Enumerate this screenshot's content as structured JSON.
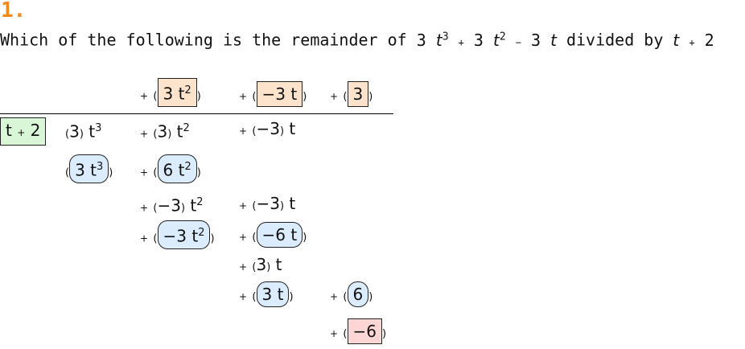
{
  "question": {
    "number": "1.",
    "prompt_before": "Which of the following is the remainder of",
    "prompt_after": "divided by",
    "dividend": {
      "c1": "3",
      "v1": "t",
      "e1": "3",
      "op1": "+",
      "c2": "3",
      "v2": "t",
      "e2": "2",
      "op2": "−",
      "c3": "3",
      "v3": "t"
    },
    "divisor": {
      "v": "t",
      "op": "+",
      "c": "2"
    }
  },
  "division": {
    "quotient": [
      {
        "op": "+",
        "content": "3 t",
        "exp": "2"
      },
      {
        "op": "+",
        "content": "−3 t",
        "exp": ""
      },
      {
        "op": "+",
        "content": "3",
        "exp": ""
      }
    ],
    "divisor_box": {
      "v": "t",
      "op": "+",
      "c": "2"
    },
    "dividend_row": [
      {
        "op": "",
        "coef": "3",
        "var": "t",
        "exp": "3"
      },
      {
        "op": "+",
        "coef": "3",
        "var": "t",
        "exp": "2"
      },
      {
        "op": "+",
        "coef": "−3",
        "var": "t",
        "exp": ""
      }
    ],
    "step1_product": [
      {
        "op": "",
        "content": "3 t",
        "exp": "3"
      },
      {
        "op": "+",
        "content": "6 t",
        "exp": "2"
      }
    ],
    "step1_remainder": [
      {
        "op": "+",
        "coef": "−3",
        "var": "t",
        "exp": "2"
      },
      {
        "op": "+",
        "coef": "−3",
        "var": "t",
        "exp": ""
      }
    ],
    "step2_product": [
      {
        "op": "+",
        "content": "−3 t",
        "exp": "2"
      },
      {
        "op": "+",
        "content": "−6 t",
        "exp": ""
      }
    ],
    "step2_remainder": {
      "op": "+",
      "coef": "3",
      "var": "t"
    },
    "step3_product": [
      {
        "op": "+",
        "content": "3 t"
      },
      {
        "op": "+",
        "content": "6"
      }
    ],
    "final_remainder": {
      "op": "+",
      "content": "−6"
    }
  },
  "colors": {
    "question_number": "#f08a1c",
    "quotient_fill": "#fde3cc",
    "divisor_fill": "#d9f7d6",
    "product_fill": "#dcecff",
    "remainder_fill": "#fcd5d5"
  }
}
